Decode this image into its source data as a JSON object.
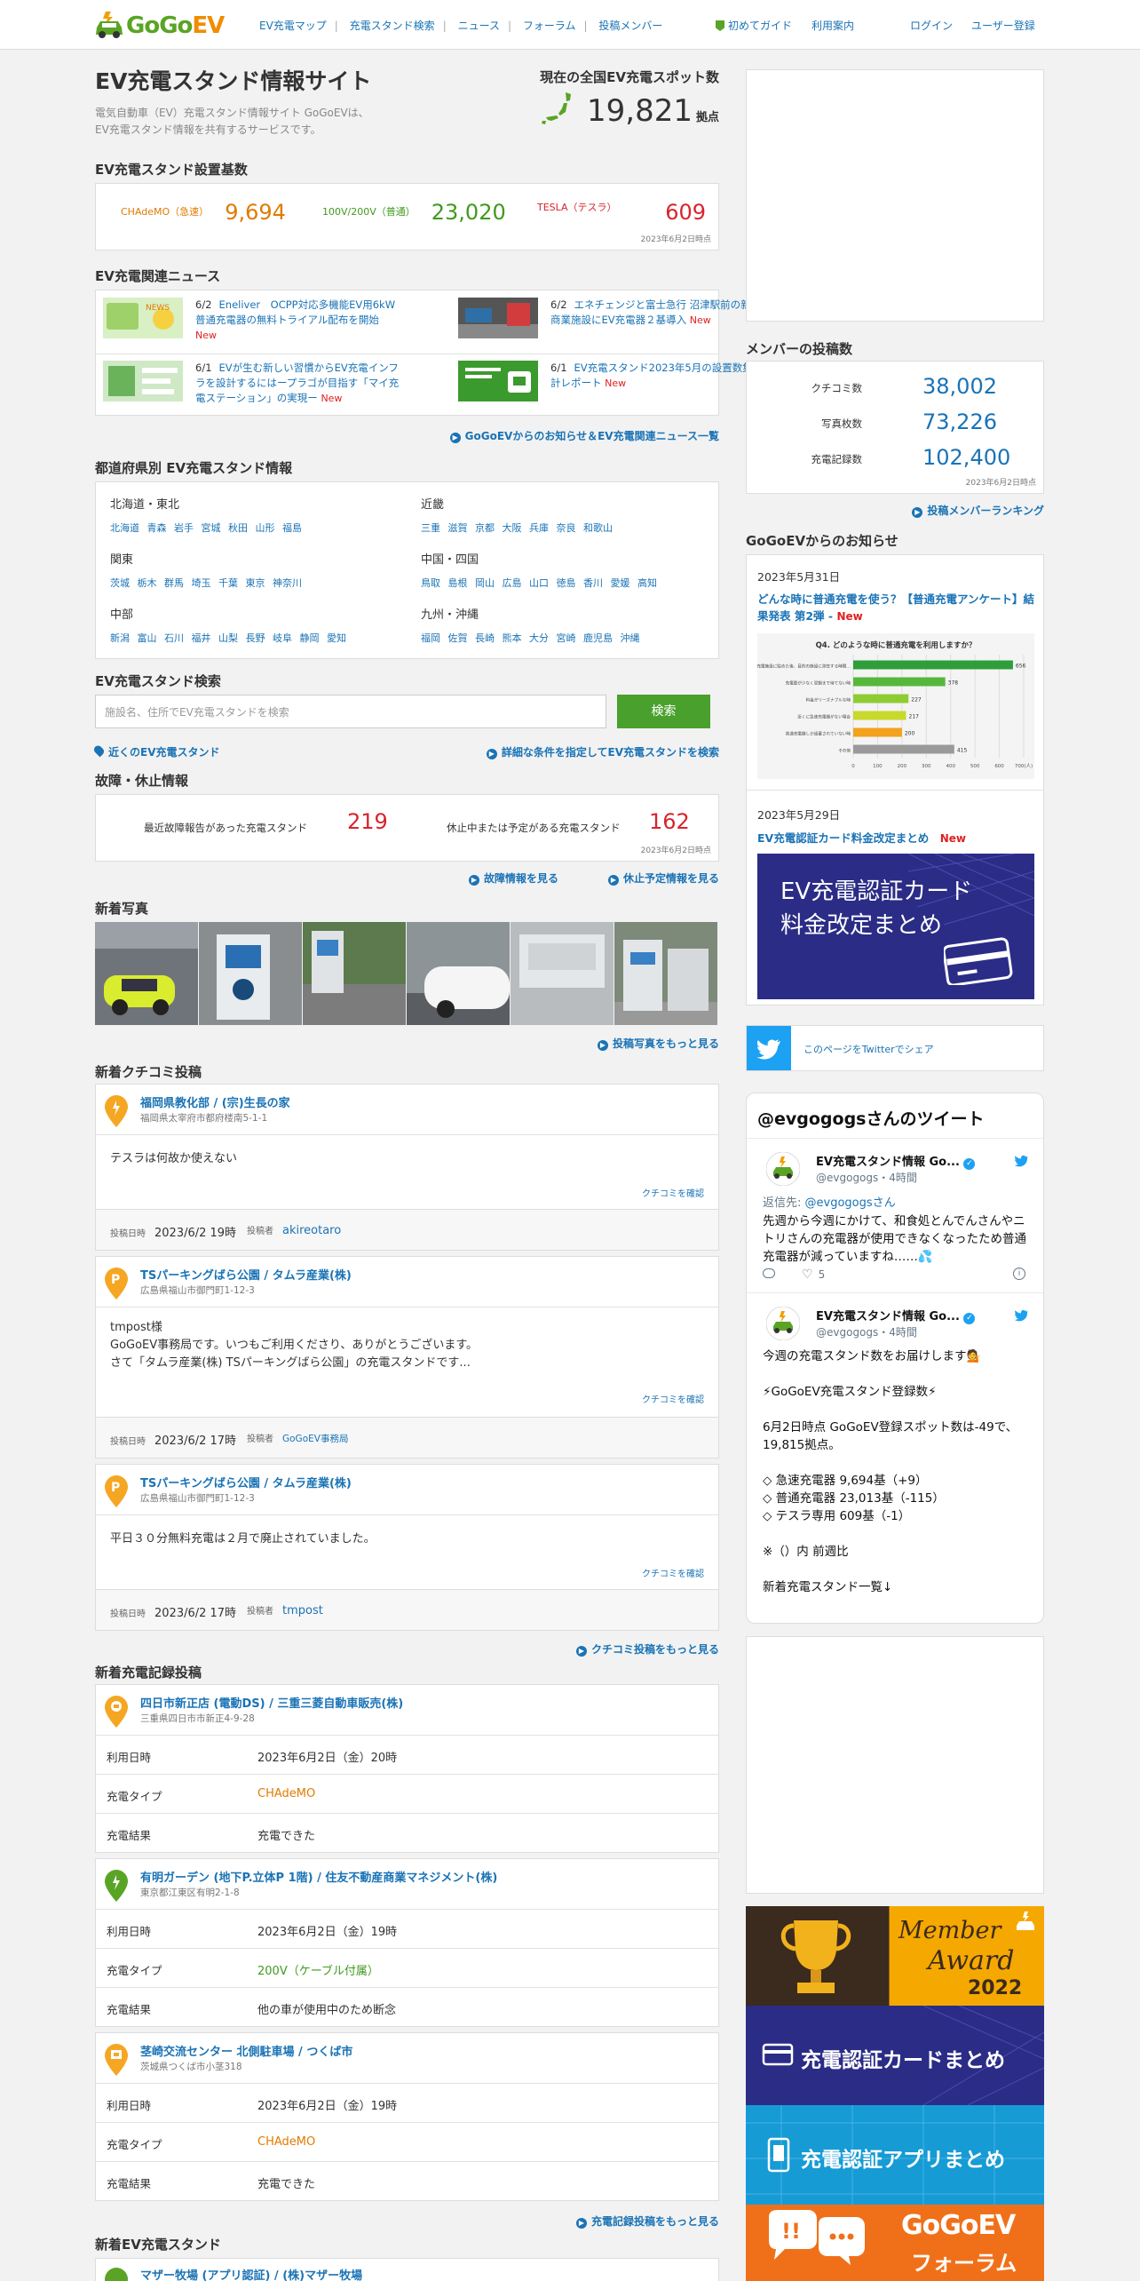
{
  "header": {
    "logo": "GoGoEV",
    "nav": [
      "EV充電マップ",
      "充電スタンド検索",
      "ニュース",
      "フォーラム",
      "投稿メンバー"
    ],
    "guide": "初めてガイド",
    "usage": "利用案内",
    "login": "ログイン",
    "register": "ユーザー登録"
  },
  "site": {
    "title": "EV充電スタンド情報サイト",
    "desc1": "電気自動車（EV）充電スタンド情報サイト GoGoEVは、",
    "desc2": "EV充電スタンド情報を共有するサービスです。",
    "count_title": "現在の全国EV充電スポット数",
    "count": "19,821",
    "count_unit": "拠点"
  },
  "install": {
    "title": "EV充電スタンド設置基数",
    "items": [
      {
        "label": "CHAdeMO（急速）",
        "value": "9,694",
        "color": "#e07b00"
      },
      {
        "label": "100V/200V（普通）",
        "value": "23,020",
        "color": "#3f9a1e"
      },
      {
        "label": "TESLA（テスラ）",
        "value": "609",
        "color": "#d9232e"
      }
    ],
    "asof": "2023年6月2日時点"
  },
  "news": {
    "title": "EV充電関連ニュース",
    "items": [
      {
        "date": "6/2",
        "text": "Eneliver　OCPP対応多機能EV用6kW普通充電器の無料トライアル配布を開始",
        "new": "New"
      },
      {
        "date": "6/2",
        "text": "エネチェンジと富士急行 沼津駅前の新商業施設にEV充電器２基導入",
        "new": "New"
      },
      {
        "date": "6/1",
        "text": "EVが生む新しい習慣からEV充電インフラを設計するにはープラゴが目指す「マイ充電ステーション」の実現ー",
        "new": "New"
      },
      {
        "date": "6/1",
        "text": "EV充電スタンド2023年5月の設置数集計レポート",
        "new": "New"
      }
    ],
    "more": "GoGoEVからのお知らせ＆EV充電関連ニュース一覧"
  },
  "pref": {
    "title": "都道府県別 EV充電スタンド情報",
    "groups": [
      {
        "region": "北海道・東北",
        "list": "北海道 青森 岩手 宮城 秋田 山形 福島"
      },
      {
        "region": "近畿",
        "list": "三重 滋賀 京都 大阪 兵庫 奈良 和歌山"
      },
      {
        "region": "関東",
        "list": "茨城 栃木 群馬 埼玉 千葉 東京 神奈川"
      },
      {
        "region": "中国・四国",
        "list": "鳥取 島根 岡山 広島 山口 徳島 香川 愛媛 高知"
      },
      {
        "region": "中部",
        "list": "新潟 富山 石川 福井 山梨 長野 岐阜 静岡 愛知"
      },
      {
        "region": "九州・沖縄",
        "list": "福岡 佐賀 長崎 熊本 大分 宮崎 鹿児島 沖縄"
      }
    ]
  },
  "search": {
    "title": "EV充電スタンド検索",
    "placeholder": "施設名、住所でEV充電スタンドを検索",
    "button": "検索",
    "near": "近くのEV充電スタンド",
    "detail": "詳細な条件を指定してEV充電スタンドを検索"
  },
  "failure": {
    "title": "故障・休止情報",
    "label1": "最近故障報告があった充電スタンド",
    "value1": "219",
    "label2": "休止中または予定がある充電スタンド",
    "value2": "162",
    "asof": "2023年6月2日時点",
    "link1": "故障情報を見る",
    "link2": "休止予定情報を見る"
  },
  "photos": {
    "title": "新着写真",
    "more": "投稿写真をもっと見る"
  },
  "reviews": {
    "title": "新着クチコミ投稿",
    "check": "クチコミを確認",
    "date_label": "投稿日時",
    "poster_label": "投稿者",
    "items": [
      {
        "name": "福岡県教化部 / (宗)生長の家",
        "addr": "福岡県太宰府市都府楼南5-1-1",
        "body1": "テスラは何故か使えない",
        "body2": "",
        "body3": "",
        "date": "2023/6/2 19時",
        "poster": "akireotaro"
      },
      {
        "name": "TSパーキングばら公園 / タムラ産業(株)",
        "addr": "広島県福山市御門町1-12-3",
        "body1": "tmpost様",
        "body2": "GoGoEV事務局です。いつもご利用くださり、ありがとうございます。",
        "body3": "さて「タムラ産業(株) TSパーキングばら公園」の充電スタンドです...",
        "date": "2023/6/2 17時",
        "poster": "GoGoEV事務局"
      },
      {
        "name": "TSパーキングばら公園 / タムラ産業(株)",
        "addr": "広島県福山市御門町1-12-3",
        "body1": "平日３０分無料充電は２月で廃止されていました。",
        "body2": "",
        "body3": "",
        "date": "2023/6/2 17時",
        "poster": "tmpost"
      }
    ],
    "more": "クチコミ投稿をもっと見る"
  },
  "records": {
    "title": "新着充電記録投稿",
    "k_time": "利用日時",
    "k_type": "充電タイプ",
    "k_result": "充電結果",
    "items": [
      {
        "name": "四日市新正店 (電動DS) / 三重三菱自動車販売(株)",
        "addr": "三重県四日市市新正4-9-28",
        "time": "2023年6月2日（金）20時",
        "type": "CHAdeMO",
        "type_color": "#e07b00",
        "result": "充電できた"
      },
      {
        "name": "有明ガーデン (地下P.立体P 1階) / 住友不動産商業マネジメント(株)",
        "addr": "東京都江東区有明2-1-8",
        "time": "2023年6月2日（金）19時",
        "type": "200V（ケーブル付属）",
        "type_color": "#3f9a1e",
        "result": "他の車が使用中のため断念"
      },
      {
        "name": "茎崎交流センター 北側駐車場 / つくば市",
        "addr": "茨城県つくば市小茎318",
        "time": "2023年6月2日（金）19時",
        "type": "CHAdeMO",
        "type_color": "#e07b00",
        "result": "充電できた"
      }
    ],
    "more": "充電記録投稿をもっと見る"
  },
  "new_stand": {
    "title": "新着EV充電スタンド",
    "first": "マザー牧場 (アプリ認証) / (株)マザー牧場"
  },
  "members": {
    "title": "メンバーの投稿数",
    "rows": [
      {
        "label": "クチコミ数",
        "value": "38,002"
      },
      {
        "label": "写真枚数",
        "value": "73,226"
      },
      {
        "label": "充電記録数",
        "value": "102,400"
      }
    ],
    "asof": "2023年6月2日時点",
    "ranking": "投稿メンバーランキング"
  },
  "notice": {
    "title": "GoGoEVからのお知らせ",
    "date1": "2023年5月31日",
    "text1": "どんな時に普通充電を使う？【普通充電アンケート】結果発表 第2弾 - ",
    "new1": "New",
    "chart_title": "Q4. どのような時に普通充電を利用しますか？",
    "date2": "2023年5月29日",
    "text2": "EV充電認証カード料金改定まとめ",
    "new2": "New",
    "banner_line1": "EV充電認証カード",
    "banner_line2": "料金改定まとめ"
  },
  "chart_data": {
    "type": "bar",
    "title": "Q4. どのような時に普通充電を利用しますか？",
    "categories": [
      "充電施設に駐めた後、目的の施設に滞在する時間を有効活用したい時",
      "充電量が少なく翌朝まで待てない時",
      "料金がリーズナブルな時",
      "近くに急速充電器がない場合",
      "普通充電器しか設置されていない時",
      "その他"
    ],
    "values": [
      656,
      378,
      227,
      217,
      200,
      415
    ],
    "xlim": [
      0,
      700
    ],
    "xticks": [
      "0",
      "100",
      "200",
      "300",
      "400",
      "500",
      "600",
      "700(人)"
    ]
  },
  "twitter": {
    "share": "このページをTwitterでシェア",
    "timeline": "@evgogogsさんのツイート",
    "author": "EV充電スタンド情報 Go...",
    "handle": "@evgogogs・4時間",
    "reply_prefix": "返信先: ",
    "reply_to": "@evgogogsさん",
    "t1": "先週から今週にかけて、和食処とんでんさんやニトリさんの充電器が使用できなくなったため普通充電器が減っていますね……💦",
    "likes": "5",
    "t2": [
      "今週の充電スタンド数をお届けします💁",
      "",
      "⚡GoGoEV充電スタンド登録数⚡",
      "",
      "6月2日時点 GoGoEV登録スポット数は-49で、19,815拠点。",
      "",
      "◇ 急速充電器 9,694基（+9）",
      "◇ 普通充電器 23,013基（-115）",
      "◇ テスラ専用 609基（-1）",
      "",
      "※（）内 前週比",
      "",
      "新着充電スタンド一覧↓"
    ]
  },
  "banners": {
    "b1a": "Member",
    "b1b": "Award",
    "b1c": "2022",
    "b2": "充電認証カードまとめ",
    "b3": "充電認証アプリまとめ",
    "b4a": "GoGoEV",
    "b4b": "フォーラム"
  }
}
